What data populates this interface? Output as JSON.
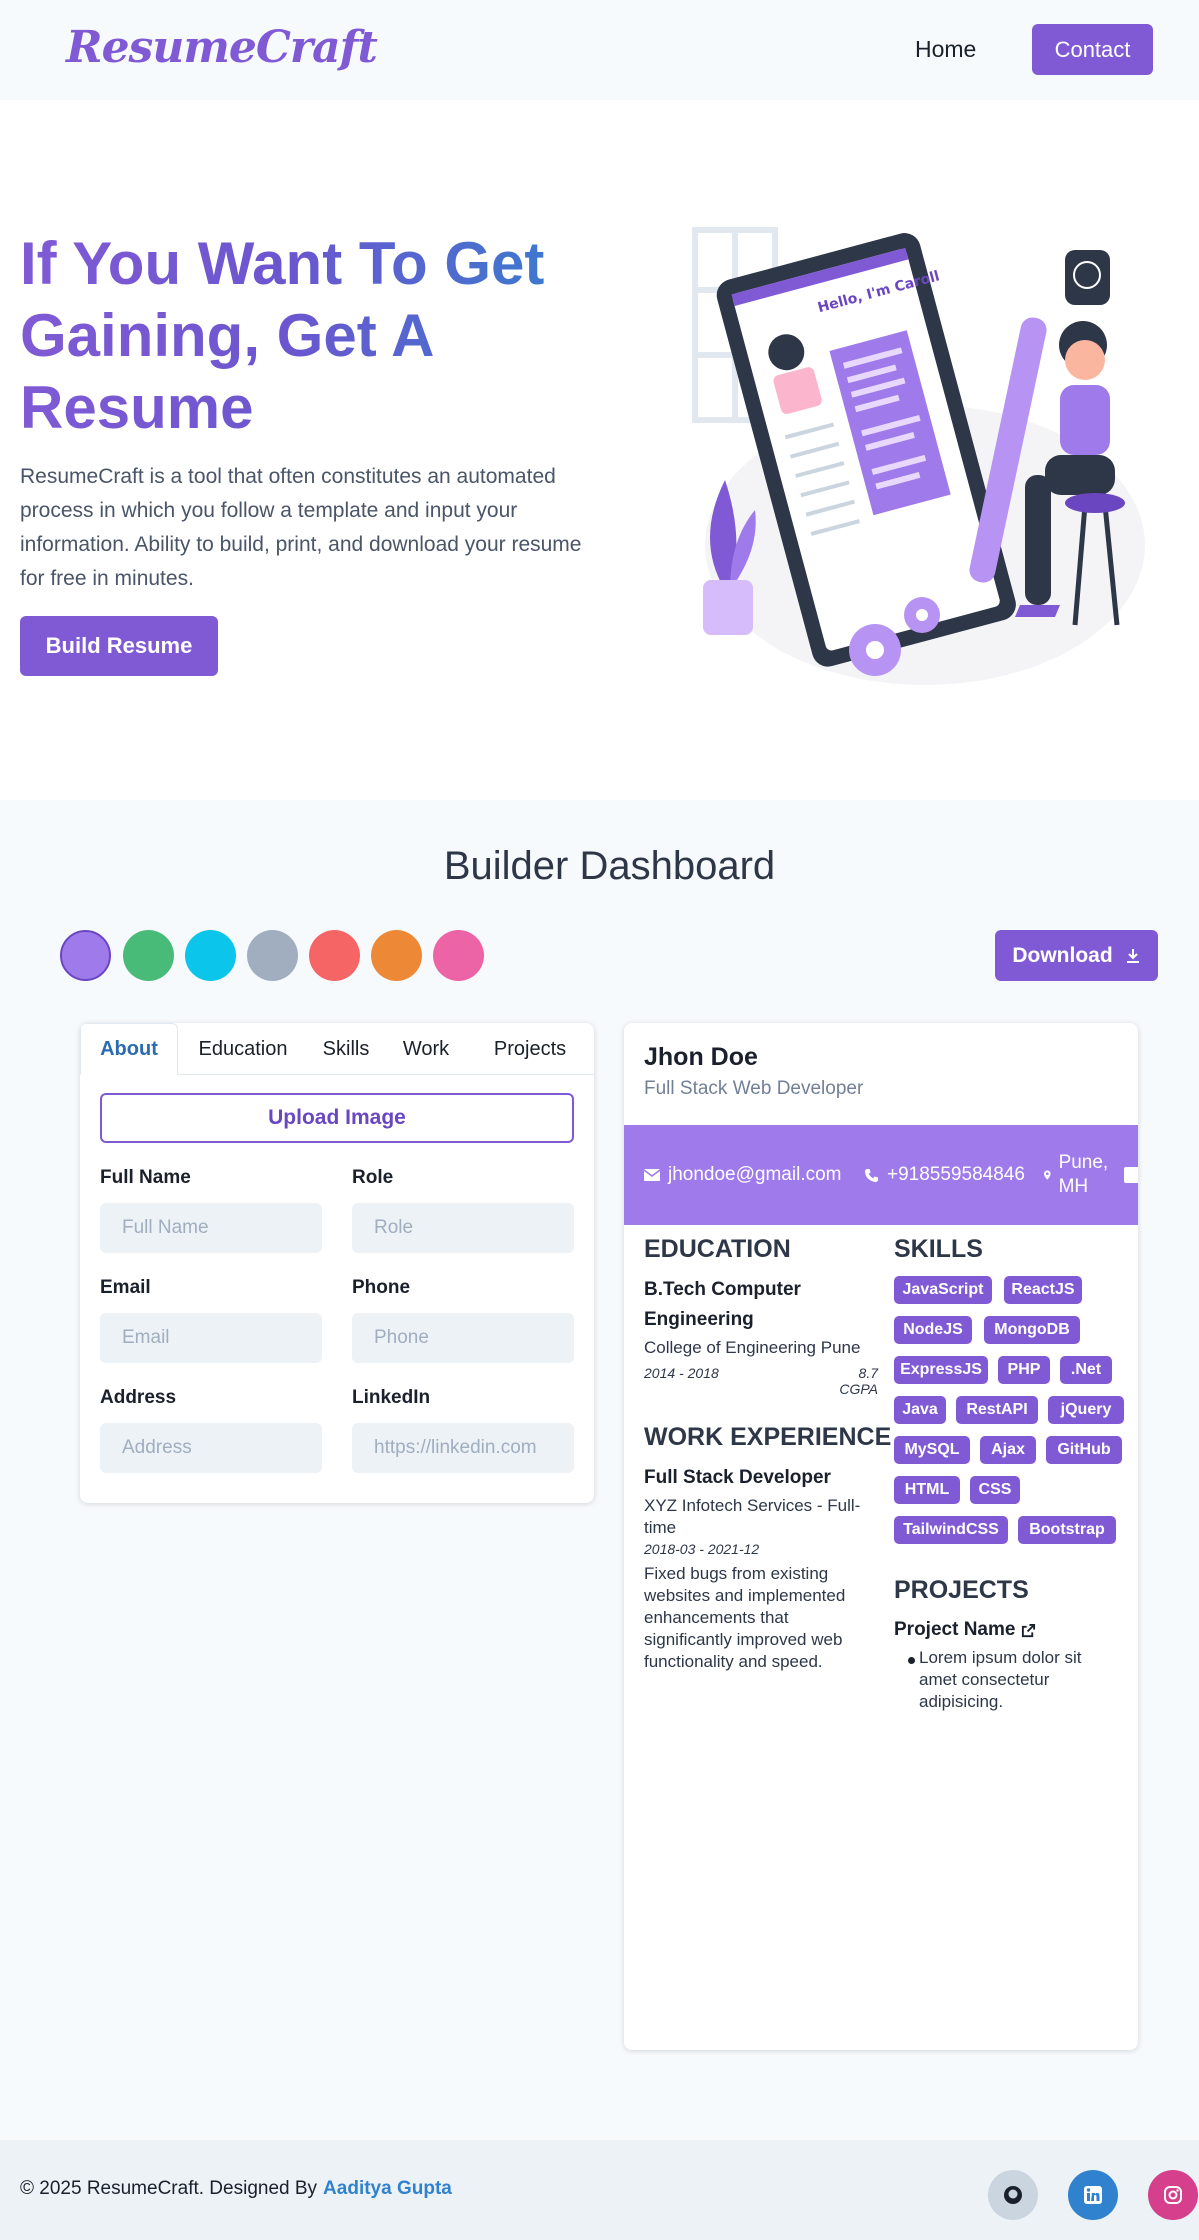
{
  "nav": {
    "logo": "ResumeCraft",
    "home": "Home",
    "contact": "Contact"
  },
  "hero": {
    "title": "If You Want To Get Gaining, Get A Resume",
    "description": "ResumeCraft is a tool that often constitutes an automated process in which you follow a template and input your information. Ability to build, print, and download your resume for free in minutes.",
    "cta": "Build Resume",
    "illustration_text": "Hello, I'm Caroll"
  },
  "dashboard": {
    "title": "Builder Dashboard",
    "theme_colors": [
      "#9f7aea",
      "#48bb78",
      "#0bc5ea",
      "#a0aec0",
      "#f56565",
      "#ed8936",
      "#ed64a6"
    ],
    "selected_color": "#9f7aea",
    "download_label": "Download"
  },
  "form": {
    "tabs": [
      "About",
      "Education",
      "Skills",
      "Work",
      "Projects"
    ],
    "active_tab": "About",
    "upload_label": "Upload Image",
    "fields": {
      "full_name": {
        "label": "Full Name",
        "placeholder": "Full Name",
        "value": ""
      },
      "role": {
        "label": "Role",
        "placeholder": "Role",
        "value": ""
      },
      "email": {
        "label": "Email",
        "placeholder": "Email",
        "value": ""
      },
      "phone": {
        "label": "Phone",
        "placeholder": "Phone",
        "value": ""
      },
      "address": {
        "label": "Address",
        "placeholder": "Address",
        "value": ""
      },
      "linkedin": {
        "label": "LinkedIn",
        "placeholder": "https://linkedin.com",
        "value": ""
      }
    }
  },
  "preview": {
    "name": "Jhon Doe",
    "role": "Full Stack Web Developer",
    "contact": {
      "email": "jhondoe@gmail.com",
      "phone": "+918559584846",
      "location": "Pune, MH"
    },
    "education": {
      "heading": "EDUCATION",
      "degree": "B.Tech Computer Engineering",
      "school": "College of Engineering Pune",
      "years": "2014 - 2018",
      "grade": "8.7 CGPA"
    },
    "work": {
      "heading": "WORK EXPERIENCE",
      "position": "Full Stack Developer",
      "company": "XYZ Infotech Services - Full-time",
      "dates": "2018-03 - 2021-12",
      "description": "Fixed bugs from existing websites and implemented enhancements that significantly improved web functionality and speed."
    },
    "skills": {
      "heading": "SKILLS",
      "items": [
        "JavaScript",
        "ReactJS",
        "NodeJS",
        "MongoDB",
        "ExpressJS",
        "PHP",
        ".Net",
        "Java",
        "RestAPI",
        "jQuery",
        "MySQL",
        "Ajax",
        "GitHub",
        "HTML",
        "CSS",
        "TailwindCSS",
        "Bootstrap"
      ]
    },
    "projects": {
      "heading": "PROJECTS",
      "name": "Project Name",
      "bullet": "Lorem ipsum dolor sit amet consectetur adipisicing."
    }
  },
  "footer": {
    "text": "© 2025 ResumeCraft. Designed By",
    "author": "Aaditya Gupta",
    "social": [
      "github-icon",
      "linkedin-icon",
      "instagram-icon"
    ]
  }
}
